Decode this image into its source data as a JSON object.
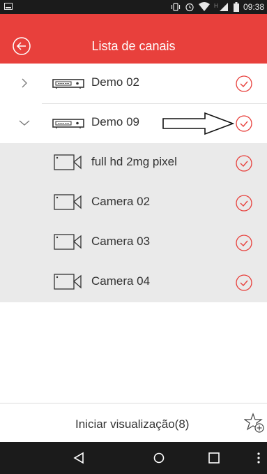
{
  "status_bar": {
    "time": "09:38",
    "icons": [
      "notification-icon",
      "vibrate-icon",
      "alarm-icon",
      "wifi-icon",
      "signal-icon",
      "battery-icon"
    ]
  },
  "header": {
    "title": "Lista de canais",
    "back_icon": "back-circle-icon"
  },
  "devices": [
    {
      "label": "Demo 02",
      "expanded": false,
      "checked": true
    },
    {
      "label": "Demo 09",
      "expanded": true,
      "checked": true
    }
  ],
  "channels": [
    {
      "label": "full hd  2mg pixel",
      "checked": true
    },
    {
      "label": "Camera 02",
      "checked": true
    },
    {
      "label": "Camera 03",
      "checked": true
    },
    {
      "label": "Camera 04",
      "checked": true
    }
  ],
  "footer": {
    "start_label": "Iniciar visualização(8)",
    "favorite_icon": "star-add-icon"
  },
  "nav": {
    "icons": [
      "nav-back-icon",
      "nav-home-icon",
      "nav-recent-icon",
      "overflow-icon"
    ]
  },
  "colors": {
    "accent": "#e8403c",
    "channel_bg": "#eaeaea",
    "system_bar": "#1b1b1b"
  }
}
